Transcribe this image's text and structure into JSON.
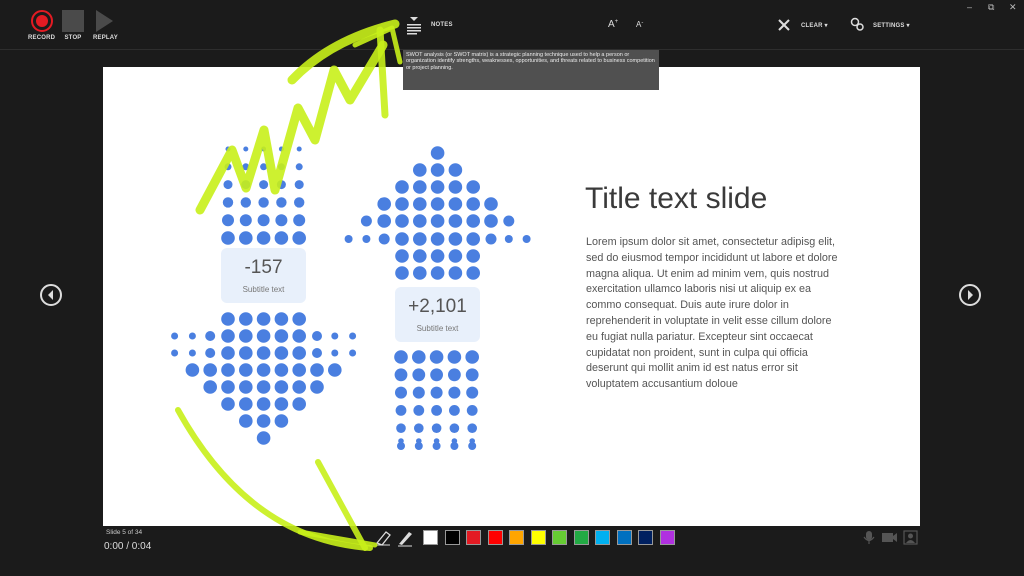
{
  "toolbar": {
    "record_label": "RECORD",
    "stop_label": "STOP",
    "replay_label": "REPLAY",
    "notes_label": "NOTES",
    "font_increase_icon": "A",
    "font_decrease_icon": "A",
    "clear_label": "CLEAR ▾",
    "settings_label": "SETTINGS ▾",
    "window_minimize": "–",
    "window_restore": "⧉",
    "window_close": "✕"
  },
  "notes": {
    "text": "SWOT analysis (or SWOT matrix) is a strategic planning technique used to help a person or organization identify strengths, weaknesses, opportunities, and threats related to business competition or project planning."
  },
  "slide": {
    "title": "Title text slide",
    "body": "Lorem ipsum dolor sit amet, consectetur adipisg elit, sed do eiusmod tempor incididunt ut labore et dolore magna aliqua. Ut enim ad minim vem, quis nostrud exercitation ullamco laboris nisi ut aliquip ex ea commo consequat. Duis aute irure dolor in reprehenderit in voluptate in velit esse cillum dolore eu fugiat nulla pariatur. Excepteur sint occaecat cupidatat non proident, sunt in culpa qui officia deserunt qui mollit anim id est natus error sit voluptatem accusantium doloue",
    "stat_left": {
      "value": "-157",
      "subtitle": "Subtitle text"
    },
    "stat_right": {
      "value": "+2,101",
      "subtitle": "Subtitle text"
    },
    "dot_color": "#4a7fe0"
  },
  "status": {
    "slide_counter": "Slide 5 of 34",
    "time": "0:00 / 0:04"
  },
  "ink_colors": [
    "#ffffff",
    "#000000",
    "#e31b23",
    "#ff0000",
    "#ffa500",
    "#ffff00",
    "#66cc33",
    "#22aa44",
    "#00b0f0",
    "#0070c0",
    "#002060",
    "#b030e0"
  ],
  "ink_stroke_color": "#c8ef1a"
}
